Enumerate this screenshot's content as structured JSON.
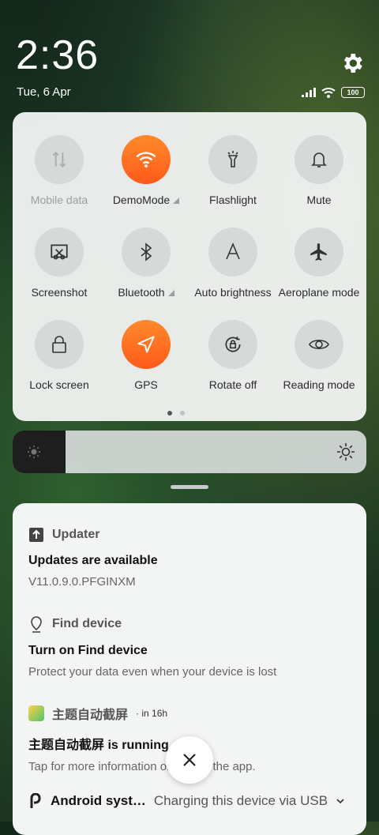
{
  "status_bar": {
    "time": "2:36",
    "date": "Tue, 6 Apr",
    "battery": "100"
  },
  "quick_settings": {
    "tiles": [
      {
        "label": "Mobile data",
        "icon": "mobile-data-icon",
        "on": false,
        "disabled": true,
        "expandable": false
      },
      {
        "label": "DemoMode",
        "icon": "wifi-icon",
        "on": true,
        "disabled": false,
        "expandable": true
      },
      {
        "label": "Flashlight",
        "icon": "flashlight-icon",
        "on": false,
        "disabled": false,
        "expandable": false
      },
      {
        "label": "Mute",
        "icon": "bell-icon",
        "on": false,
        "disabled": false,
        "expandable": false
      },
      {
        "label": "Screenshot",
        "icon": "screenshot-icon",
        "on": false,
        "disabled": false,
        "expandable": false
      },
      {
        "label": "Bluetooth",
        "icon": "bluetooth-icon",
        "on": false,
        "disabled": false,
        "expandable": true
      },
      {
        "label": "Auto brightness",
        "icon": "auto-brightness-icon",
        "on": false,
        "disabled": false,
        "expandable": false
      },
      {
        "label": "Aeroplane mode",
        "icon": "airplane-icon",
        "on": false,
        "disabled": false,
        "expandable": false
      },
      {
        "label": "Lock screen",
        "icon": "lock-icon",
        "on": false,
        "disabled": false,
        "expandable": false
      },
      {
        "label": "GPS",
        "icon": "gps-icon",
        "on": true,
        "disabled": false,
        "expandable": false
      },
      {
        "label": "Rotate off",
        "icon": "rotate-lock-icon",
        "on": false,
        "disabled": false,
        "expandable": false
      },
      {
        "label": "Reading mode",
        "icon": "eye-icon",
        "on": false,
        "disabled": false,
        "expandable": false
      }
    ],
    "page_indicator": {
      "pages": 2,
      "active": 1
    }
  },
  "brightness": {
    "level": 0.15
  },
  "notifications": [
    {
      "app": "Updater",
      "title": "Updates are available",
      "body": "V11.0.9.0.PFGINXM",
      "time": ""
    },
    {
      "app": "Find device",
      "title": "Turn on Find device",
      "body": "Protect your data even when your device is lost",
      "time": ""
    },
    {
      "app": "主题自动截屏",
      "title": "主题自动截屏 is running",
      "body": "Tap for more information or to stop the app.",
      "time": "in 16h"
    }
  ],
  "bottom_notification": {
    "app": "Android syst…",
    "text": "Charging this device via USB"
  },
  "colors": {
    "accent": "#ff6a1f",
    "panel": "#f0f2f1"
  }
}
